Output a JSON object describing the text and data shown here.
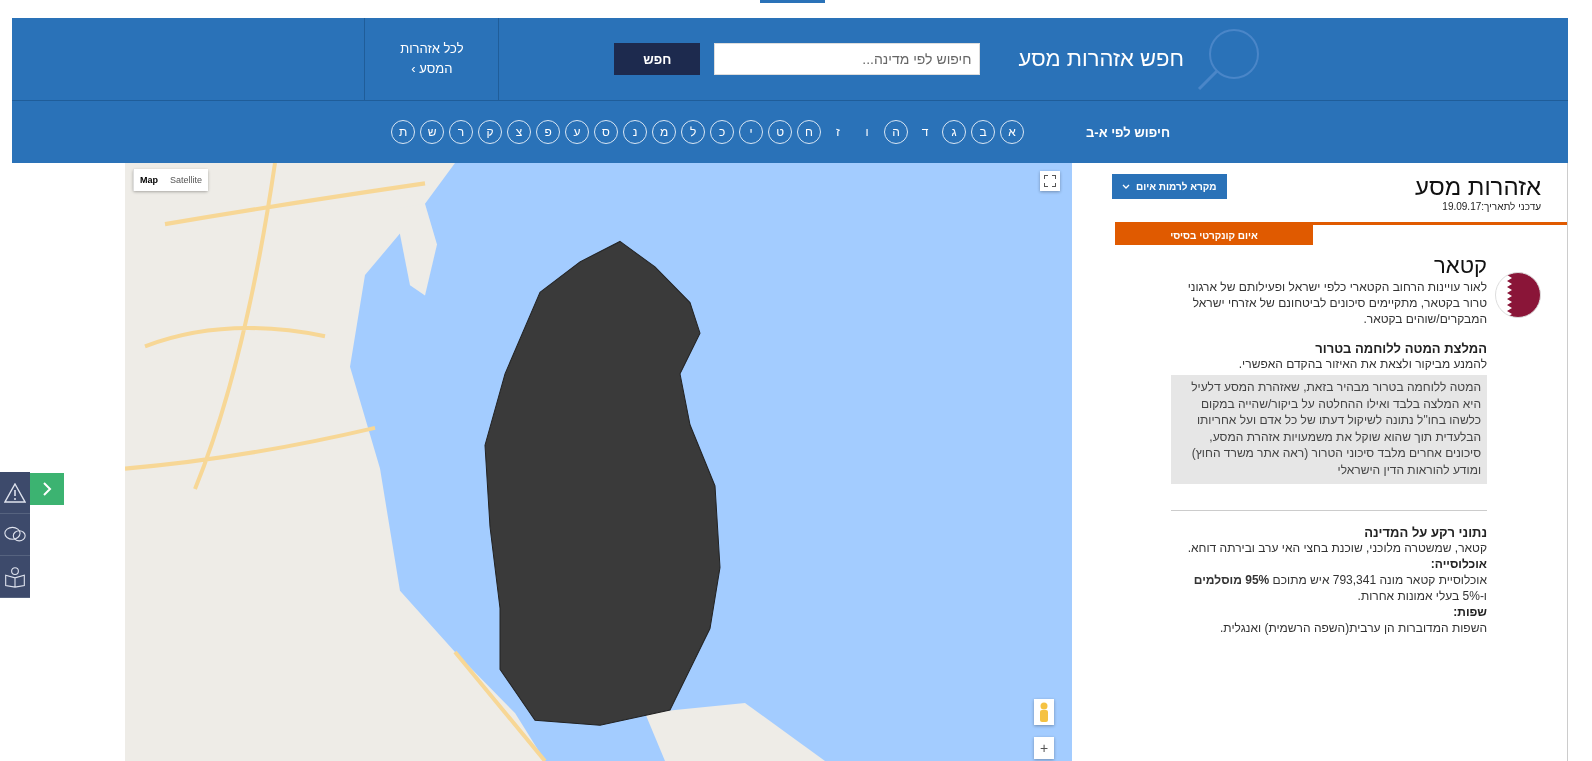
{
  "header": {
    "title": "חפש אזהרות מסע",
    "search": {
      "placeholder": "חיפוש לפי מדינה..."
    },
    "search_button": "חפש",
    "all_warnings_link": {
      "line_1": "לכל אזהרות",
      "line_2": "המסע ›"
    }
  },
  "alphabet": {
    "label": "חיפוש לפי א-ב",
    "letters": [
      {
        "letter": "א",
        "available": true
      },
      {
        "letter": "ב",
        "available": true
      },
      {
        "letter": "ג",
        "available": true
      },
      {
        "letter": "ד",
        "available": false
      },
      {
        "letter": "ה",
        "available": true
      },
      {
        "letter": "ו",
        "available": false
      },
      {
        "letter": "ז",
        "available": false
      },
      {
        "letter": "ח",
        "available": true
      },
      {
        "letter": "ט",
        "available": true
      },
      {
        "letter": "י",
        "available": true
      },
      {
        "letter": "כ",
        "available": true
      },
      {
        "letter": "ל",
        "available": true
      },
      {
        "letter": "מ",
        "available": true
      },
      {
        "letter": "נ",
        "available": true
      },
      {
        "letter": "ס",
        "available": true
      },
      {
        "letter": "ע",
        "available": true
      },
      {
        "letter": "פ",
        "available": true
      },
      {
        "letter": "צ",
        "available": true
      },
      {
        "letter": "ק",
        "available": true
      },
      {
        "letter": "ר",
        "available": true
      },
      {
        "letter": "ש",
        "available": true
      },
      {
        "letter": "ת",
        "available": true
      }
    ]
  },
  "map": {
    "map_types": [
      {
        "label": "Satellite",
        "selected": false
      },
      {
        "label": "Map",
        "selected": true
      }
    ],
    "zoom_in": "+"
  },
  "warnings": {
    "title": "אזהרות מסע",
    "updated": "עדכני לתאריך:19.09.17",
    "legend_button": "מקרא לרמות איום",
    "threat_level": "איום קונקרטי בסיסי",
    "country": {
      "name": "קטאר",
      "summary": "לאור עויינות הרחוב הקטארי כלפי ישראל ופעילותם של ארגוני טרור בקטאר, מתקיימים סיכונים לביטחונם של אזרחי ישראל המבקרים/שוהים בקטאר."
    },
    "recommendation": {
      "title": "המלצת המטה ללוחמה בטרור",
      "text": "להמנע מביקור ולצאת את האיזור בהקדם האפשרי.",
      "note": "המטה ללוחמה בטרור מבהיר בזאת, שאזהרת המסע דלעיל היא המלצה בלבד ואילו ההחלטה על ביקור/שהייה במקום כלשהו בחו\"ל נתונה לשיקול דעתו של כל אדם ועל אחריותו הבלעדית תוך שהוא שוקל את משמעויות אזהרת המסע, סיכונים אחרים מלבד סיכוני הטרור (ראה אתר משרד החוץ) ומודע להוראות הדין הישראלי"
    },
    "background": {
      "title": "נתוני רקע על המדינה",
      "text": "קטאר, שמשטרה מלוכני, שוכנת בחצי האי ערב ובירתה דוחא.",
      "population_label": "אוכלוסייה:",
      "population_text": "אוכלוסיית קטאר מונה 793,341 איש מתוכם **95% מוסלמים** ו-5% בעלי אמונות אחרות.",
      "languages_label": "שפות:",
      "languages_text": "השפות המדוברות הן ערבית(השפה הרשמית) ואנגלית."
    }
  }
}
